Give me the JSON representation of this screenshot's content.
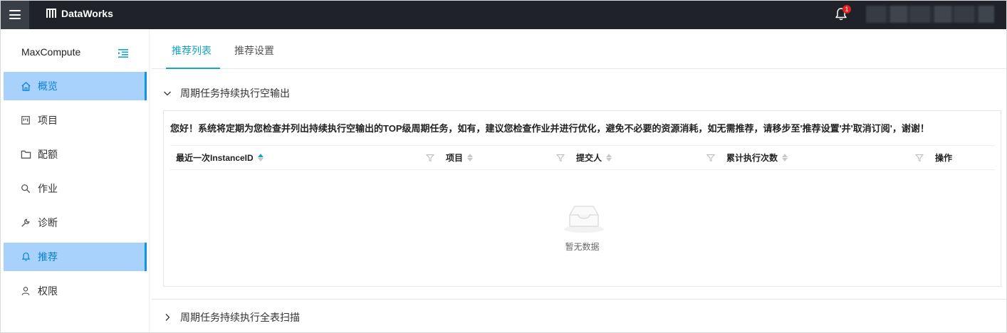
{
  "topbar": {
    "brand": "DataWorks",
    "notification_count": "1"
  },
  "sidebar": {
    "title": "MaxCompute",
    "items": [
      {
        "label": "概览",
        "icon": "home-icon",
        "active": true
      },
      {
        "label": "项目",
        "icon": "project-icon",
        "active": false
      },
      {
        "label": "配额",
        "icon": "folder-icon",
        "active": false
      },
      {
        "label": "作业",
        "icon": "search-icon",
        "active": false
      },
      {
        "label": "诊断",
        "icon": "wrench-icon",
        "active": false
      },
      {
        "label": "推荐",
        "icon": "bell-icon",
        "active": true
      },
      {
        "label": "权限",
        "icon": "user-icon",
        "active": false
      }
    ]
  },
  "tabs": [
    {
      "label": "推荐列表",
      "active": true
    },
    {
      "label": "推荐设置",
      "active": false
    }
  ],
  "sections": [
    {
      "title": "周期任务持续执行空输出",
      "expanded": true
    },
    {
      "title": "周期任务持续执行全表扫描",
      "expanded": false
    }
  ],
  "panel": {
    "notice": "您好！系统将定期为您检查并列出持续执行空输出的TOP级周期任务，如有，建议您检查作业并进行优化，避免不必要的资源消耗，如无需推荐，请移步至'推荐设置'并'取消订阅'，谢谢！",
    "columns": [
      {
        "label": "最近一次InstanceID",
        "sortable": true,
        "sort": "asc",
        "filterable": true
      },
      {
        "label": "项目",
        "sortable": true,
        "filterable": true
      },
      {
        "label": "提交人",
        "sortable": true,
        "filterable": true
      },
      {
        "label": "累计执行次数",
        "sortable": true,
        "filterable": true
      },
      {
        "label": "操作",
        "sortable": false,
        "filterable": false
      }
    ],
    "empty_text": "暂无数据"
  },
  "colors": {
    "topbar": "#1f2329",
    "accent": "#12a6c4",
    "active_bg": "#a8d2fb",
    "badge": "#e02020"
  }
}
